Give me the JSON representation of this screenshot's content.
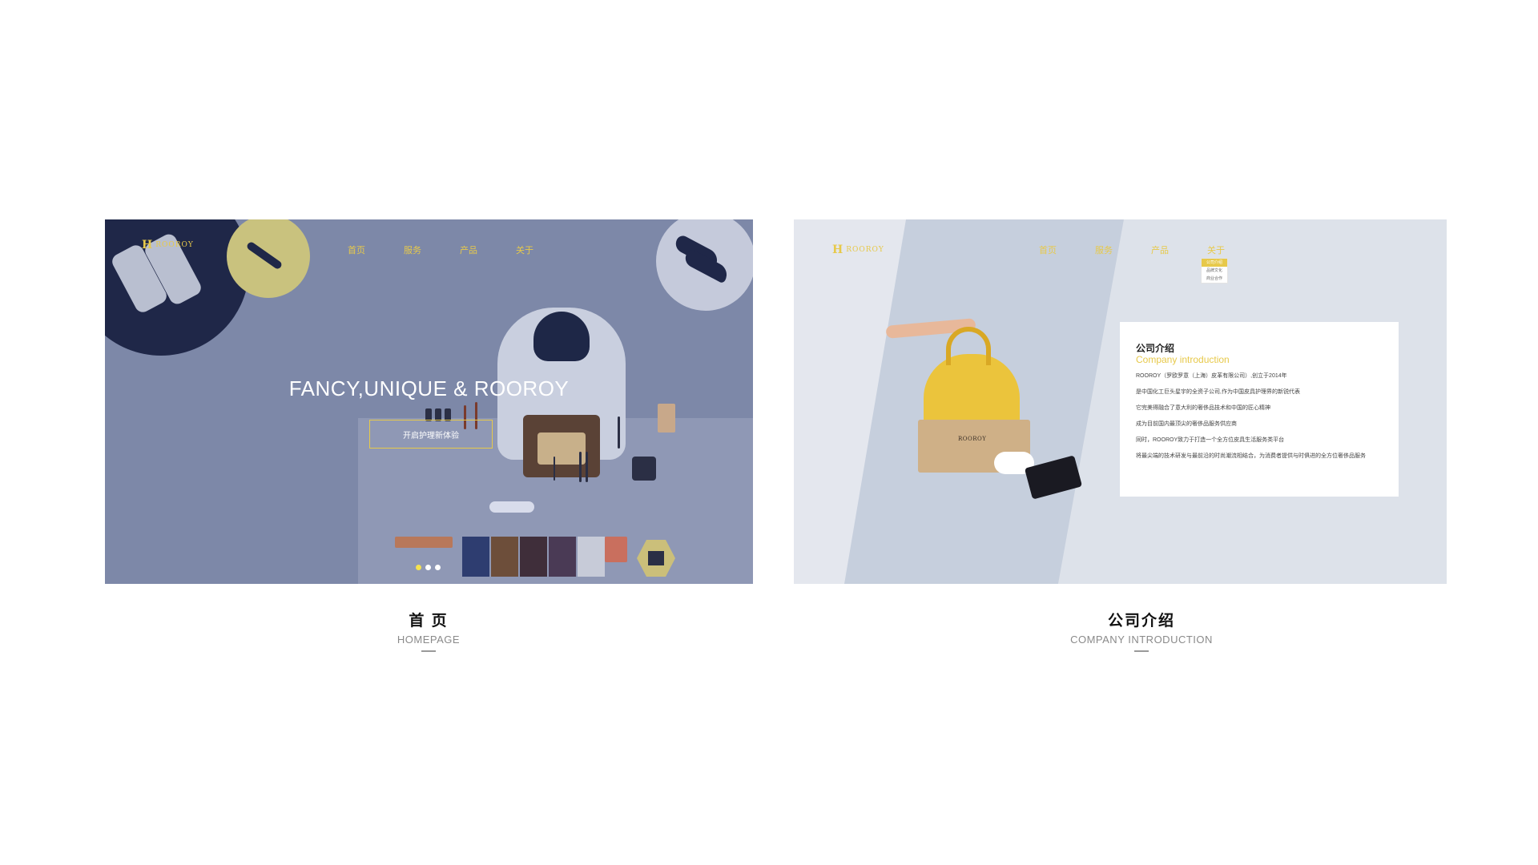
{
  "homepage": {
    "logo": "ROOROY",
    "nav": [
      "首页",
      "服务",
      "产品",
      "关于"
    ],
    "hero_title": "FANCY,UNIQUE & ROOROY",
    "hero_button": "开启护理新体验",
    "carousel": {
      "count": 3,
      "active_index": 0
    }
  },
  "company": {
    "logo": "ROOROY",
    "nav": [
      "首页",
      "服务",
      "产品",
      "关于"
    ],
    "dropdown": [
      "公司介绍",
      "品牌文化",
      "商业合作"
    ],
    "box_logo": "ROOROY",
    "card": {
      "title": "公司介绍",
      "subtitle": "Company introduction",
      "lines": [
        "ROOROY（罗欧罗意（上海）皮革有限公司）,创立于2014年",
        "是中国化工巨头星宇的全资子公司,作为中国皮具护理界的新锐代表",
        "它完美得融合了意大利的奢侈品技术和中国的匠心精神",
        "成为目前国内最顶尖的奢侈品服务供应商",
        "同时，ROOROY致力于打造一个全方位皮具生活服务类平台",
        "将最尖端的技术研发与最前沿的时尚潮流相结合，为消费者提供与时俱进的全方位奢侈品服务"
      ]
    }
  },
  "captions": [
    {
      "title": "首 页",
      "subtitle": "HOMEPAGE"
    },
    {
      "title": "公司介绍",
      "subtitle": "COMPANY INTRODUCTION"
    }
  ],
  "colors": {
    "accent": "#e7c94a",
    "home_bg": "#7d88a8",
    "navy": "#1f2748"
  }
}
